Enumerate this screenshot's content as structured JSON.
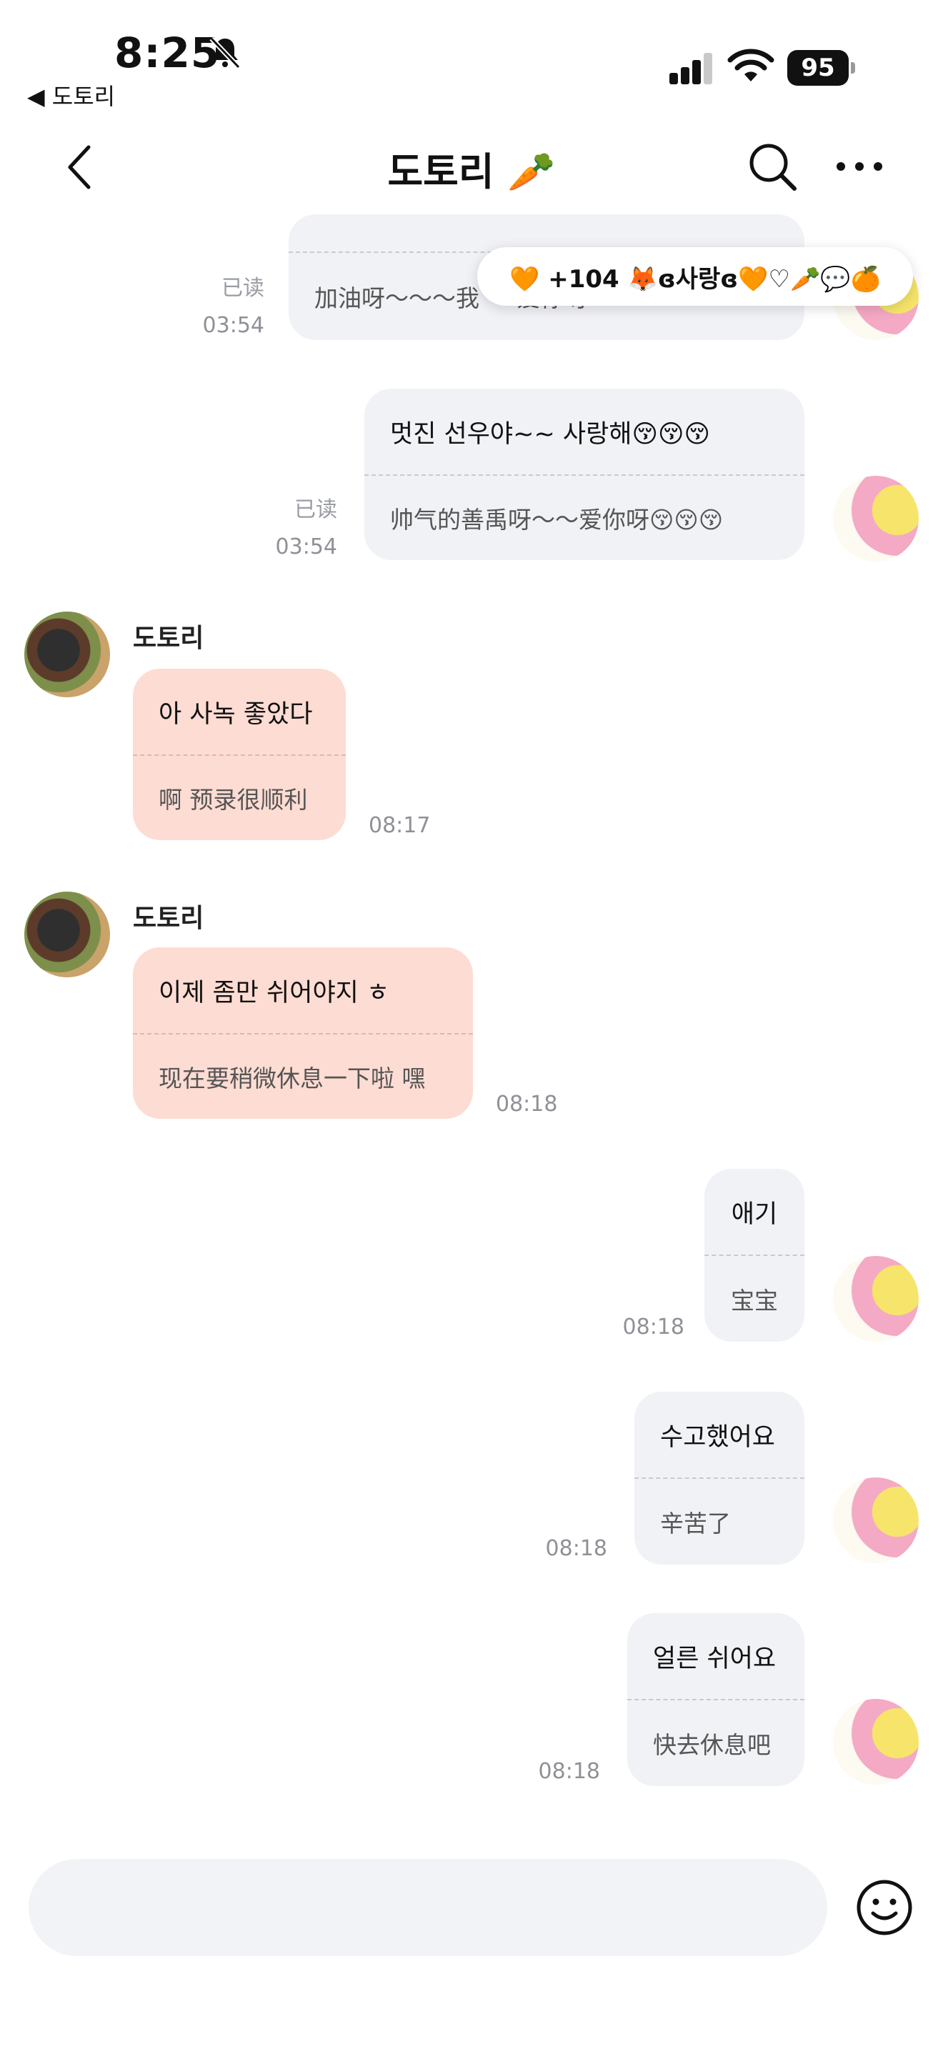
{
  "status_bar": {
    "time": "8:25",
    "back_app": "◀ 도토리",
    "battery": "95"
  },
  "nav": {
    "title": "도토리 🥕"
  },
  "reaction": {
    "text": "🧡 +104 🦊ɞ사랑ɞ🧡♡🥕💬🍊"
  },
  "messages": [
    {
      "side": "mine",
      "ko": "",
      "zh": "加油呀～～～我 ··· 爱你呀",
      "read": "已读",
      "time": "03:54"
    },
    {
      "side": "mine",
      "ko": "멋진 선우야~~ 사랑해😚😚😚",
      "zh": "帅气的善禹呀～～爱你呀😚😚😚",
      "read": "已读",
      "time": "03:54"
    },
    {
      "side": "theirs",
      "sender": "도토리",
      "ko": "아 사녹 좋았다",
      "zh": "啊 预录很顺利",
      "time": "08:17"
    },
    {
      "side": "theirs",
      "sender": "도토리",
      "ko": "이제 좀만 쉬어야지 ㅎ",
      "zh": "现在要稍微休息一下啦 嘿",
      "time": "08:18"
    },
    {
      "side": "mine",
      "ko": "애기",
      "zh": "宝宝",
      "time": "08:18"
    },
    {
      "side": "mine",
      "ko": "수고했어요",
      "zh": "辛苦了",
      "time": "08:18"
    },
    {
      "side": "mine",
      "ko": "얼른 쉬어요",
      "zh": "快去休息吧",
      "time": "08:18"
    }
  ],
  "input": {
    "placeholder": ""
  }
}
